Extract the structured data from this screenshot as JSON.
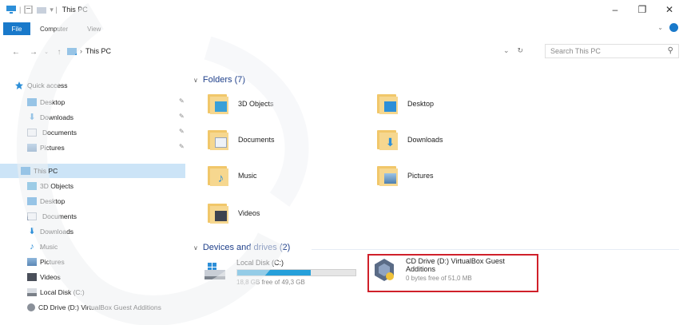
{
  "window": {
    "title": "This PC",
    "controls": [
      "–",
      "❐",
      "✕"
    ]
  },
  "ribbon": {
    "tabs": [
      "File",
      "Computer",
      "View"
    ]
  },
  "address": {
    "path": "This PC",
    "search_placeholder": "Search This PC"
  },
  "nav": {
    "quick_access": "Quick access",
    "quick_items": [
      "Desktop",
      "Downloads",
      "Documents",
      "Pictures"
    ],
    "this_pc": "This PC",
    "pc_items": [
      "3D Objects",
      "Desktop",
      "Documents",
      "Downloads",
      "Music",
      "Pictures",
      "Videos",
      "Local Disk (C:)",
      "CD Drive (D:) VirtualBox Guest Additions"
    ]
  },
  "folders": {
    "heading": "Folders (7)",
    "items": [
      "3D Objects",
      "Desktop",
      "Documents",
      "Downloads",
      "Music",
      "Pictures",
      "Videos"
    ]
  },
  "drives": {
    "heading": "Devices and drives (2)",
    "local": {
      "name": "Local Disk (C:)",
      "free": "18,8 GB free of 49,3 GB",
      "used_fraction": 0.62
    },
    "cd": {
      "name_line1": "CD Drive (D:) VirtualBox Guest",
      "name_line2": "Additions",
      "free": "0 bytes free of 51,0 MB"
    }
  },
  "colors": {
    "accent": "#1979ca",
    "selection": "#cce4f7",
    "highlight_box": "#d0202a",
    "folder": "#f1c76a"
  }
}
